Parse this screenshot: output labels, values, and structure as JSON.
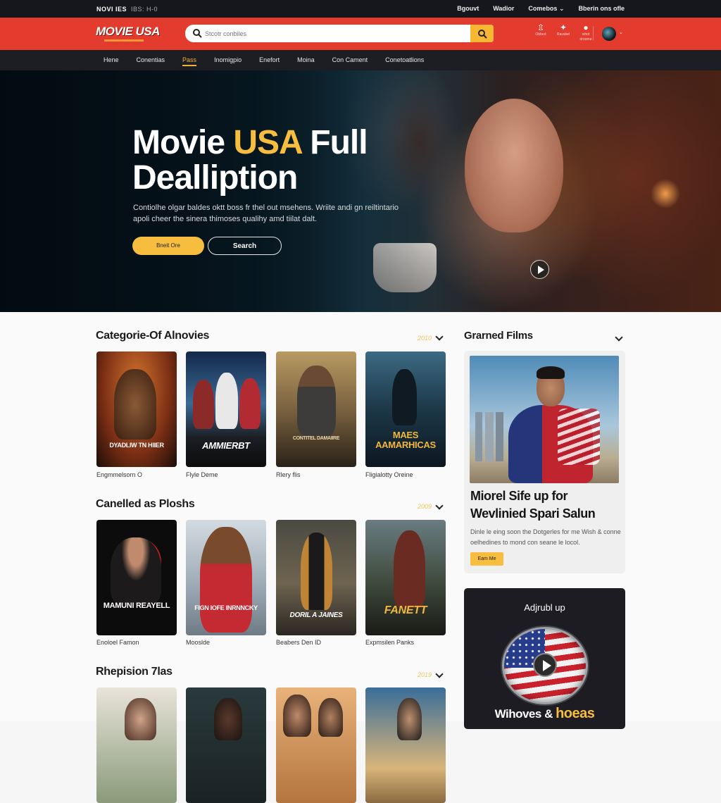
{
  "topbar": {
    "brand": "NOVI IES",
    "brand_sub": "IBS: H-0",
    "links": [
      "Bgouvt",
      "Wadior",
      "Comebos",
      "Bberin ons ofle"
    ]
  },
  "header": {
    "logo": "MOVIE USA",
    "search_placeholder": "Stcotr conbiles",
    "icons": [
      {
        "icon": "upload-icon",
        "label": "Obbert"
      },
      {
        "icon": "run-icon",
        "label": "Ravsbel"
      },
      {
        "icon": "notification-icon",
        "label": "whot droome"
      }
    ]
  },
  "nav": {
    "items": [
      "Hene",
      "Conentias",
      "Pass",
      "Inomigpio",
      "Enefort",
      "Moina",
      "Con Cament",
      "Conetoatlions"
    ],
    "active_index": 2
  },
  "hero": {
    "title_part1": "Movie ",
    "title_accent": "USA",
    "title_part2": " Full",
    "title_line2": "Dealliption",
    "description": "Contiolhe olgar baldes oktt boss fr thel out msehens. Wriite andi gn reiltintario apoli cheer the sinera thimoses qualihy amd tiilat dalt.",
    "primary_button": "Bneit Ore",
    "secondary_button": "Search"
  },
  "sections": [
    {
      "title": "Categorie-Of Alnovies",
      "year": "2010",
      "items": [
        {
          "poster_title": "DYADLIW TN HIIER",
          "caption": "Engmmelsorn O"
        },
        {
          "poster_title": "AMMIERBT",
          "caption": "Flyle Deme"
        },
        {
          "poster_title": "CONTITEL DAMAIIRE",
          "caption": "Rlery flis"
        },
        {
          "poster_title": "MAES AAMARHICAS",
          "caption": "Fligialotty Oreine"
        }
      ]
    },
    {
      "title": "Canelled as Ploshs",
      "year": "2009",
      "items": [
        {
          "poster_title": "MAMUNI REAYELL",
          "caption": "Enoloel Famon"
        },
        {
          "poster_title": "FIGN IOFE INRNNCKY",
          "caption": "Mooslde"
        },
        {
          "poster_title": "DORIL A JAINES",
          "caption": "Beabers Den ID"
        },
        {
          "poster_title": "FANETT",
          "caption": "Expmsilen Panks"
        }
      ]
    },
    {
      "title": "Rhepision 7las",
      "year": "2019",
      "items": [
        {
          "poster_title": "",
          "caption": ""
        },
        {
          "poster_title": "",
          "caption": ""
        },
        {
          "poster_title": "",
          "caption": ""
        },
        {
          "poster_title": "",
          "caption": ""
        }
      ]
    }
  ],
  "sidebar": {
    "title": "Grarned Films",
    "feature": {
      "headline": "Miorel Sife up for Wevlinied Spari Salun",
      "description": "Dinle le eing soon the Dotgerles for me Wish & conne oelhedines to mond con seane le locol.",
      "button": "Eam Me"
    },
    "video": {
      "title": "Adjrubl up",
      "footer_text": "Wihoves & ",
      "footer_accent": "hoeas"
    }
  }
}
